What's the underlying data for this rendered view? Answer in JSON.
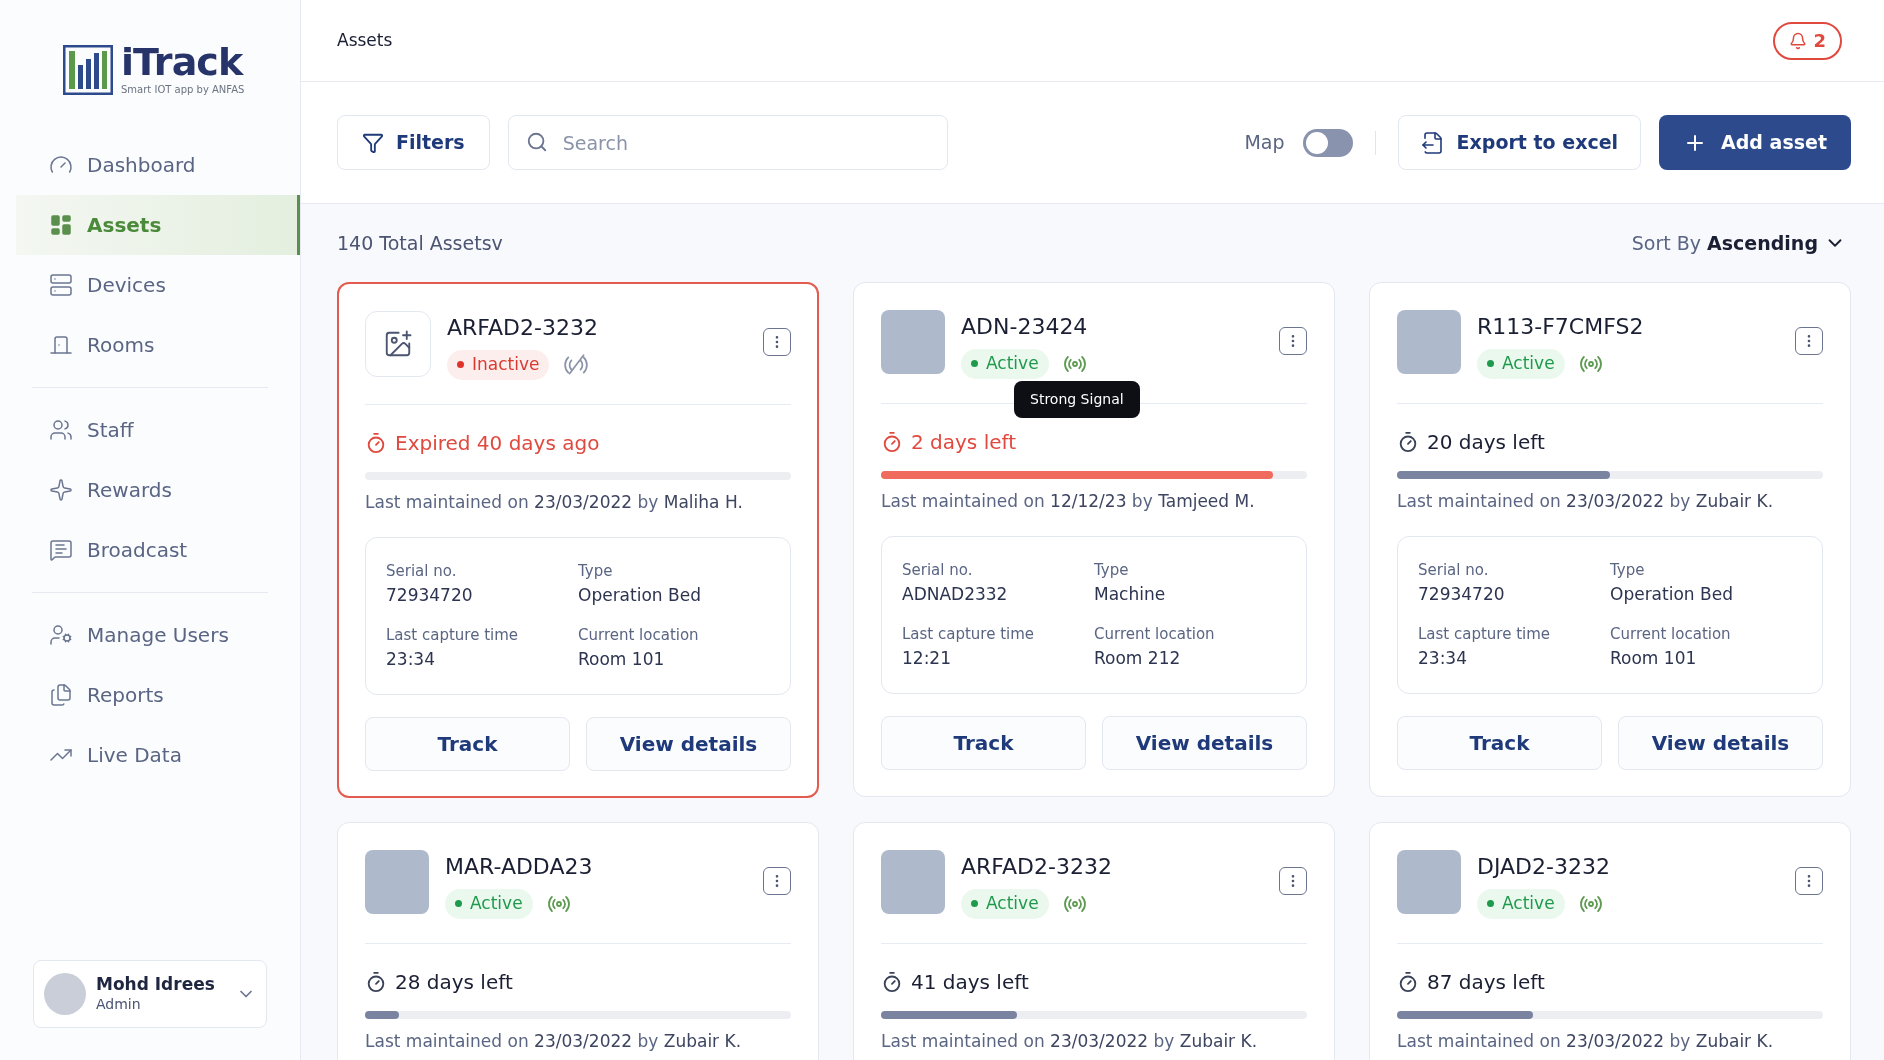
{
  "logo": {
    "name": "iTrack",
    "tagline": "Smart IOT app by ANFAS"
  },
  "sidebar": {
    "groups": [
      [
        {
          "label": "Dashboard",
          "selected": false
        },
        {
          "label": "Assets",
          "selected": true
        },
        {
          "label": "Devices",
          "selected": false
        },
        {
          "label": "Rooms",
          "selected": false
        }
      ],
      [
        {
          "label": "Staff",
          "selected": false
        },
        {
          "label": "Rewards",
          "selected": false
        },
        {
          "label": "Broadcast",
          "selected": false
        }
      ],
      [
        {
          "label": "Manage Users",
          "selected": false
        },
        {
          "label": "Reports",
          "selected": false
        },
        {
          "label": "Live Data",
          "selected": false
        }
      ]
    ]
  },
  "user": {
    "name": "Mohd Idrees",
    "role": "Admin"
  },
  "header": {
    "title": "Assets",
    "notifications": "2"
  },
  "toolbar": {
    "filters": "Filters",
    "search_placeholder": "Search",
    "map_label": "Map",
    "map_on": false,
    "export": "Export to excel",
    "add": "Add asset"
  },
  "summary": "140 Total Assetsv",
  "sort": {
    "label": "Sort By",
    "value": "Ascending"
  },
  "assets": [
    {
      "name": "ARFAD2-3232",
      "has_photo": false,
      "status": {
        "label": "Inactive",
        "kind": "inactive"
      },
      "signal_ok": false,
      "selected": true,
      "due": "Expired 40 days ago",
      "urgent": true,
      "level": 0,
      "maintained": "Last maintained on **23/03/2022** by **Maliha H.**",
      "details": [
        {
          "label": "Serial no.",
          "value": "72934720"
        },
        {
          "label": "Type",
          "value": "Operation Bed"
        },
        {
          "label": "Last capture time",
          "value": "23:34"
        },
        {
          "label": "Current location",
          "value": "Room 101"
        }
      ],
      "actions": [
        "Track",
        "View details"
      ]
    },
    {
      "name": "ADN-23424",
      "has_photo": true,
      "status": {
        "label": "Active",
        "kind": "active"
      },
      "signal_ok": true,
      "tooltip": "Strong Signal",
      "selected": false,
      "due": "2 days left",
      "urgent": true,
      "level": 0.92,
      "maintained": "Last maintained on **12/12/23** by **Tamjeed M.**",
      "details": [
        {
          "label": "Serial no.",
          "value": "ADNAD2332"
        },
        {
          "label": "Type",
          "value": "Machine"
        },
        {
          "label": "Last capture time",
          "value": "12:21"
        },
        {
          "label": "Current location",
          "value": "Room 212"
        }
      ],
      "actions": [
        "Track",
        "View details"
      ]
    },
    {
      "name": "R113-F7CMFS2",
      "has_photo": true,
      "status": {
        "label": "Active",
        "kind": "active"
      },
      "signal_ok": true,
      "selected": false,
      "due": "20 days left",
      "urgent": false,
      "level": 0.5,
      "maintained": "Last maintained on **23/03/2022** by **Zubair K.**",
      "details": [
        {
          "label": "Serial no.",
          "value": "72934720"
        },
        {
          "label": "Type",
          "value": "Operation Bed"
        },
        {
          "label": "Last capture time",
          "value": "23:34"
        },
        {
          "label": "Current location",
          "value": "Room 101"
        }
      ],
      "actions": [
        "Track",
        "View details"
      ]
    },
    {
      "name": "MAR-ADDA23",
      "has_photo": true,
      "status": {
        "label": "Active",
        "kind": "active"
      },
      "signal_ok": true,
      "selected": false,
      "due": "28 days left",
      "urgent": false,
      "level": 0.08,
      "maintained": "Last maintained on **23/03/2022** by **Zubair K.**"
    },
    {
      "name": "ARFAD2-3232",
      "has_photo": true,
      "status": {
        "label": "Active",
        "kind": "active"
      },
      "signal_ok": true,
      "selected": false,
      "due": "41 days left",
      "urgent": false,
      "level": 0.32,
      "maintained": "Last maintained on **23/03/2022** by **Zubair K.**"
    },
    {
      "name": "DJAD2-3232",
      "has_photo": true,
      "status": {
        "label": "Active",
        "kind": "active"
      },
      "signal_ok": true,
      "selected": false,
      "due": "87 days left",
      "urgent": false,
      "level": 0.32,
      "maintained": "Last maintained on **23/03/2022** by **Zubair K.**"
    }
  ]
}
